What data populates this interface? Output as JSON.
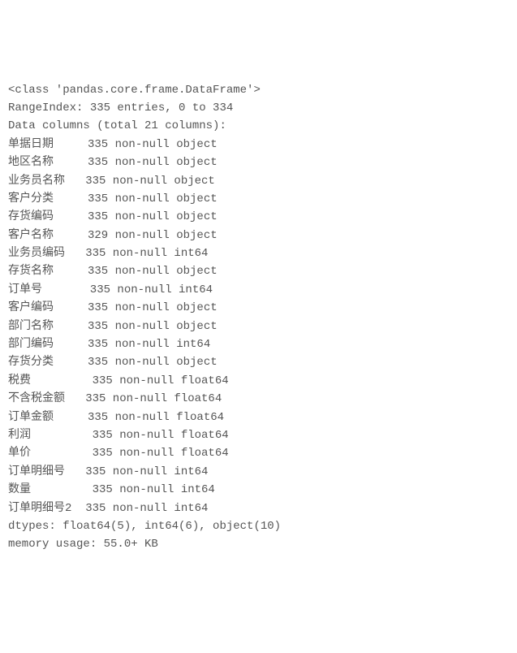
{
  "header_line": "<class 'pandas.core.frame.DataFrame'>",
  "range_index": "RangeIndex: 335 entries, 0 to 334",
  "data_columns_header": "Data columns (total 21 columns):",
  "columns": [
    {
      "name": "单据日期",
      "count": "335",
      "nullinfo": "non-null",
      "dtype": "object"
    },
    {
      "name": "地区名称",
      "count": "335",
      "nullinfo": "non-null",
      "dtype": "object"
    },
    {
      "name": "业务员名称",
      "count": "335",
      "nullinfo": "non-null",
      "dtype": "object"
    },
    {
      "name": "客户分类",
      "count": "335",
      "nullinfo": "non-null",
      "dtype": "object"
    },
    {
      "name": "存货编码",
      "count": "335",
      "nullinfo": "non-null",
      "dtype": "object"
    },
    {
      "name": "客户名称",
      "count": "329",
      "nullinfo": "non-null",
      "dtype": "object"
    },
    {
      "name": "业务员编码",
      "count": "335",
      "nullinfo": "non-null",
      "dtype": "int64"
    },
    {
      "name": "存货名称",
      "count": "335",
      "nullinfo": "non-null",
      "dtype": "object"
    },
    {
      "name": "订单号",
      "count": "335",
      "nullinfo": "non-null",
      "dtype": "int64"
    },
    {
      "name": "客户编码",
      "count": "335",
      "nullinfo": "non-null",
      "dtype": "object"
    },
    {
      "name": "部门名称",
      "count": "335",
      "nullinfo": "non-null",
      "dtype": "object"
    },
    {
      "name": "部门编码",
      "count": "335",
      "nullinfo": "non-null",
      "dtype": "int64"
    },
    {
      "name": "存货分类",
      "count": "335",
      "nullinfo": "non-null",
      "dtype": "object"
    },
    {
      "name": "税费",
      "count": "335",
      "nullinfo": "non-null",
      "dtype": "float64"
    },
    {
      "name": "不含税金额",
      "count": "335",
      "nullinfo": "non-null",
      "dtype": "float64"
    },
    {
      "name": "订单金额",
      "count": "335",
      "nullinfo": "non-null",
      "dtype": "float64"
    },
    {
      "name": "利润",
      "count": "335",
      "nullinfo": "non-null",
      "dtype": "float64"
    },
    {
      "name": "单价",
      "count": "335",
      "nullinfo": "non-null",
      "dtype": "float64"
    },
    {
      "name": "订单明细号",
      "count": "335",
      "nullinfo": "non-null",
      "dtype": "int64"
    },
    {
      "name": "数量",
      "count": "335",
      "nullinfo": "non-null",
      "dtype": "int64"
    },
    {
      "name": "订单明细号2",
      "count": "335",
      "nullinfo": "non-null",
      "dtype": "int64"
    }
  ],
  "dtypes_summary": "dtypes: float64(5), int64(6), object(10)",
  "memory_usage": "memory usage: 55.0+ KB"
}
